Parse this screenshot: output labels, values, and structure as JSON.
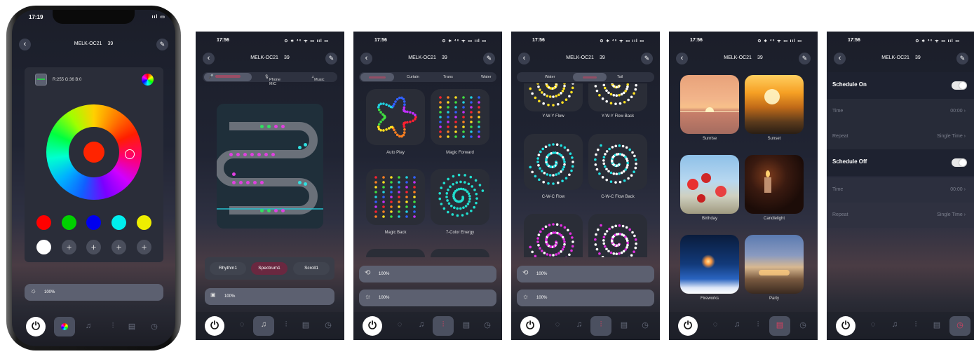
{
  "device_name": "MELK-OC21",
  "device_num": "39",
  "screen1": {
    "time": "17:19",
    "status_icons": "ııl ▭",
    "rgb_text": "R:255 G:36 B:0",
    "brightness": "100%"
  },
  "screen2": {
    "time": "17:56",
    "status_icons": "⊙ ∗ ⁴⁶ ᯤ ▭ ııl ▭",
    "tabs": [
      "Phone MIC",
      "Music"
    ],
    "modes": [
      "Rhythm1",
      "Spectrum1",
      "Scroll1"
    ],
    "sensitivity": "100%"
  },
  "screen3": {
    "time": "17:56",
    "status_icons": "⊙ ∗ ⁴⁶ ᯤ ▭ ııl ▭",
    "tabs": [
      "Curtain",
      "Trans",
      "Water"
    ],
    "effects": [
      "Auto Play",
      "Magic Forward",
      "Magic Back",
      "7-Color Energy"
    ],
    "speed": "100%",
    "brightness": "100%"
  },
  "screen4": {
    "time": "17:56",
    "status_icons": "⊙ ∗ ⁴⁶ ᯤ ▭ ııl ▭",
    "tabs": [
      "Water",
      "Tail"
    ],
    "effects": [
      "Y-W-Y Flow",
      "Y-W-Y Flow Back",
      "C-W-C Flow",
      "C-W-C Flow Back"
    ],
    "speed": "100%",
    "brightness": "100%"
  },
  "screen5": {
    "time": "17:56",
    "status_icons": "⊙ ∗ ⁴⁶ ᯤ ▭ ııl ▭",
    "scenes": [
      "Sunrise",
      "Sunset",
      "Birthday",
      "Candlelight",
      "Fireworks",
      "Party"
    ]
  },
  "screen6": {
    "time": "17:56",
    "status_icons": "⊙ ∗ ⁴⁶ ᯤ ▭ ııl ▭",
    "on_title": "Schedule On",
    "off_title": "Schedule Off",
    "time_label": "Time",
    "time_value": "00:00",
    "repeat_label": "Repeat",
    "repeat_value": "Single Time"
  },
  "colors": {
    "selected": "#ff2400",
    "presets": [
      "#ff0000",
      "#00d000",
      "#0000ee",
      "#00eeee",
      "#eeee00",
      "#ffffff"
    ]
  }
}
